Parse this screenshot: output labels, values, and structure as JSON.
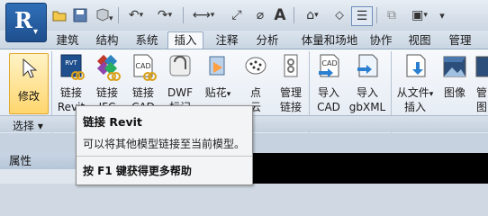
{
  "qat": {
    "app_letter": "R",
    "text_tool": "A"
  },
  "tabs": [
    "建筑",
    "结构",
    "系统",
    "插入",
    "注释",
    "分析",
    "体量和场地",
    "协作",
    "视图",
    "管理"
  ],
  "active_tab": "插入",
  "ribbon": {
    "modify": "修改",
    "link_revit": [
      "链接",
      "Revit"
    ],
    "link_ifc": [
      "链接",
      "IFC"
    ],
    "link_cad": [
      "链接",
      "CAD"
    ],
    "dwf": [
      "DWF",
      "标记"
    ],
    "decal": [
      "贴花",
      ""
    ],
    "point_cloud": [
      "点",
      "云"
    ],
    "manage_links": [
      "管理",
      "链接"
    ],
    "import_cad": [
      "导入",
      "CAD"
    ],
    "import_gbxml": [
      "导入",
      "gbXML"
    ],
    "insert_from_file": [
      "从文件",
      "插入"
    ],
    "image": [
      "图像",
      ""
    ],
    "manage_images": [
      "管",
      "图"
    ],
    "icon_texts": {
      "rvt": "RVT",
      "cad": "CAD"
    }
  },
  "panel": {
    "select_label": "选择 ▾"
  },
  "properties": {
    "title": "属性"
  },
  "tooltip": {
    "title": "链接 Revit",
    "description": "可以将其他模型链接至当前模型。",
    "help": "按 F1 键获得更多帮助"
  },
  "colors": {
    "accent": "#2f6fb8",
    "highlight": "#ffd66e",
    "canvas": "#000000"
  }
}
